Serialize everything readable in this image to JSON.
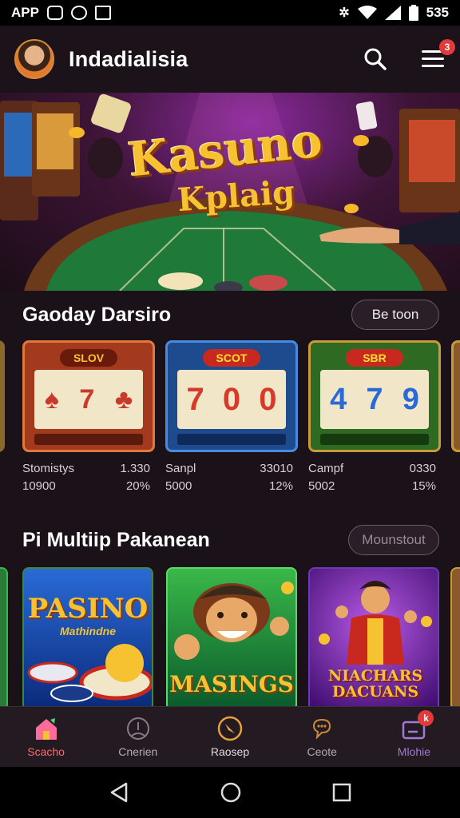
{
  "status_bar": {
    "left_text": "APP",
    "time": "535",
    "icons": [
      "instagram-icon",
      "whatsapp-icon",
      "mail-icon",
      "vibrate-icon",
      "wifi-icon",
      "signal-icon",
      "battery-icon"
    ]
  },
  "header": {
    "title": "Indadialisia",
    "menu_badge": "3",
    "icons": [
      "avatar",
      "search-icon",
      "menu-icon"
    ]
  },
  "banner": {
    "title_line1": "Kasuno",
    "title_line2": "Kplaig"
  },
  "section1": {
    "title": "Gaoday Darsiro",
    "button": "Be toon",
    "games": [
      {
        "sign": "SLOV",
        "reels": [
          "♠",
          "7",
          "♣"
        ],
        "name": "Stomistys",
        "amount": "10900",
        "value": "1.330",
        "pct": "20%",
        "colors": {
          "frame": "#a33a1e",
          "inner": "#5a1a0e"
        }
      },
      {
        "sign": "SCOT",
        "reels": [
          "7",
          "0",
          "0"
        ],
        "name": "Sanpl",
        "amount": "5000",
        "value": "33010",
        "pct": "12%",
        "colors": {
          "frame": "#2a5a9e",
          "inner": "#0e2a5a"
        }
      },
      {
        "sign": "SBR",
        "reels": [
          "4",
          "7",
          "9"
        ],
        "name": "Campf",
        "amount": "5002",
        "value": "0330",
        "pct": "15%",
        "colors": {
          "frame": "#3a7a2a",
          "inner": "#163a10"
        }
      }
    ]
  },
  "section2": {
    "title": "Pi Multiip Pakanean",
    "button": "Mounstout",
    "promos": [
      {
        "title": "PASINO",
        "subtitle": "Mathindne",
        "colors": {
          "bg1": "#2a6ad6",
          "bg2": "#0a2a7a"
        }
      },
      {
        "title": "MASINGS",
        "subtitle": "",
        "colors": {
          "bg1": "#3ab84a",
          "bg2": "#0a5a2a"
        }
      },
      {
        "title": "NIACHARS DACUANS",
        "subtitle": "",
        "colors": {
          "bg1": "#8a3ad6",
          "bg2": "#3a0a6a"
        }
      }
    ]
  },
  "bottom_nav": {
    "items": [
      {
        "label": "Scacho",
        "icon": "home-icon",
        "active": true
      },
      {
        "label": "Cnerien",
        "icon": "person-icon",
        "active": false
      },
      {
        "label": "Raosep",
        "icon": "compass-icon",
        "active": false
      },
      {
        "label": "Ceote",
        "icon": "chat-icon",
        "active": false
      },
      {
        "label": "Mlohie",
        "icon": "wallet-icon",
        "active": false,
        "badge": "k"
      }
    ]
  },
  "colors": {
    "accent": "#ff6b6b",
    "gold": "#f6b82a",
    "background": "#1a1119"
  }
}
